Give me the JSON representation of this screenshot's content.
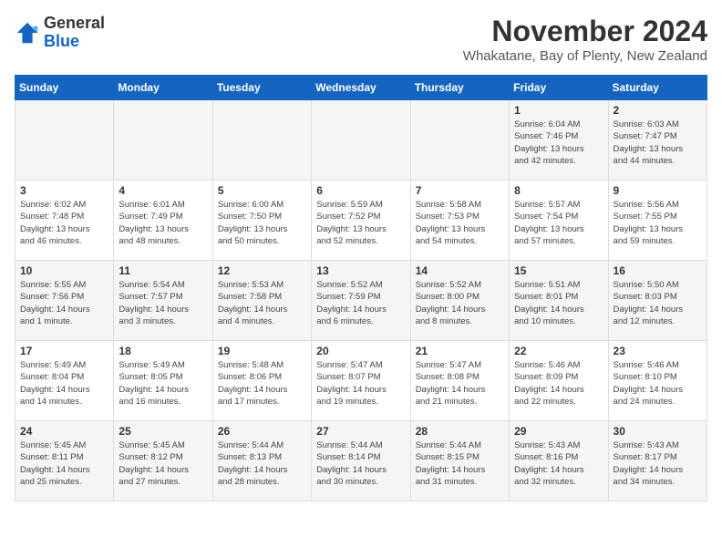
{
  "logo": {
    "line1": "General",
    "line2": "Blue"
  },
  "title": "November 2024",
  "location": "Whakatane, Bay of Plenty, New Zealand",
  "days_of_week": [
    "Sunday",
    "Monday",
    "Tuesday",
    "Wednesday",
    "Thursday",
    "Friday",
    "Saturday"
  ],
  "weeks": [
    [
      {
        "day": "",
        "info": ""
      },
      {
        "day": "",
        "info": ""
      },
      {
        "day": "",
        "info": ""
      },
      {
        "day": "",
        "info": ""
      },
      {
        "day": "",
        "info": ""
      },
      {
        "day": "1",
        "info": "Sunrise: 6:04 AM\nSunset: 7:46 PM\nDaylight: 13 hours\nand 42 minutes."
      },
      {
        "day": "2",
        "info": "Sunrise: 6:03 AM\nSunset: 7:47 PM\nDaylight: 13 hours\nand 44 minutes."
      }
    ],
    [
      {
        "day": "3",
        "info": "Sunrise: 6:02 AM\nSunset: 7:48 PM\nDaylight: 13 hours\nand 46 minutes."
      },
      {
        "day": "4",
        "info": "Sunrise: 6:01 AM\nSunset: 7:49 PM\nDaylight: 13 hours\nand 48 minutes."
      },
      {
        "day": "5",
        "info": "Sunrise: 6:00 AM\nSunset: 7:50 PM\nDaylight: 13 hours\nand 50 minutes."
      },
      {
        "day": "6",
        "info": "Sunrise: 5:59 AM\nSunset: 7:52 PM\nDaylight: 13 hours\nand 52 minutes."
      },
      {
        "day": "7",
        "info": "Sunrise: 5:58 AM\nSunset: 7:53 PM\nDaylight: 13 hours\nand 54 minutes."
      },
      {
        "day": "8",
        "info": "Sunrise: 5:57 AM\nSunset: 7:54 PM\nDaylight: 13 hours\nand 57 minutes."
      },
      {
        "day": "9",
        "info": "Sunrise: 5:56 AM\nSunset: 7:55 PM\nDaylight: 13 hours\nand 59 minutes."
      }
    ],
    [
      {
        "day": "10",
        "info": "Sunrise: 5:55 AM\nSunset: 7:56 PM\nDaylight: 14 hours\nand 1 minute."
      },
      {
        "day": "11",
        "info": "Sunrise: 5:54 AM\nSunset: 7:57 PM\nDaylight: 14 hours\nand 3 minutes."
      },
      {
        "day": "12",
        "info": "Sunrise: 5:53 AM\nSunset: 7:58 PM\nDaylight: 14 hours\nand 4 minutes."
      },
      {
        "day": "13",
        "info": "Sunrise: 5:52 AM\nSunset: 7:59 PM\nDaylight: 14 hours\nand 6 minutes."
      },
      {
        "day": "14",
        "info": "Sunrise: 5:52 AM\nSunset: 8:00 PM\nDaylight: 14 hours\nand 8 minutes."
      },
      {
        "day": "15",
        "info": "Sunrise: 5:51 AM\nSunset: 8:01 PM\nDaylight: 14 hours\nand 10 minutes."
      },
      {
        "day": "16",
        "info": "Sunrise: 5:50 AM\nSunset: 8:03 PM\nDaylight: 14 hours\nand 12 minutes."
      }
    ],
    [
      {
        "day": "17",
        "info": "Sunrise: 5:49 AM\nSunset: 8:04 PM\nDaylight: 14 hours\nand 14 minutes."
      },
      {
        "day": "18",
        "info": "Sunrise: 5:49 AM\nSunset: 8:05 PM\nDaylight: 14 hours\nand 16 minutes."
      },
      {
        "day": "19",
        "info": "Sunrise: 5:48 AM\nSunset: 8:06 PM\nDaylight: 14 hours\nand 17 minutes."
      },
      {
        "day": "20",
        "info": "Sunrise: 5:47 AM\nSunset: 8:07 PM\nDaylight: 14 hours\nand 19 minutes."
      },
      {
        "day": "21",
        "info": "Sunrise: 5:47 AM\nSunset: 8:08 PM\nDaylight: 14 hours\nand 21 minutes."
      },
      {
        "day": "22",
        "info": "Sunrise: 5:46 AM\nSunset: 8:09 PM\nDaylight: 14 hours\nand 22 minutes."
      },
      {
        "day": "23",
        "info": "Sunrise: 5:46 AM\nSunset: 8:10 PM\nDaylight: 14 hours\nand 24 minutes."
      }
    ],
    [
      {
        "day": "24",
        "info": "Sunrise: 5:45 AM\nSunset: 8:11 PM\nDaylight: 14 hours\nand 25 minutes."
      },
      {
        "day": "25",
        "info": "Sunrise: 5:45 AM\nSunset: 8:12 PM\nDaylight: 14 hours\nand 27 minutes."
      },
      {
        "day": "26",
        "info": "Sunrise: 5:44 AM\nSunset: 8:13 PM\nDaylight: 14 hours\nand 28 minutes."
      },
      {
        "day": "27",
        "info": "Sunrise: 5:44 AM\nSunset: 8:14 PM\nDaylight: 14 hours\nand 30 minutes."
      },
      {
        "day": "28",
        "info": "Sunrise: 5:44 AM\nSunset: 8:15 PM\nDaylight: 14 hours\nand 31 minutes."
      },
      {
        "day": "29",
        "info": "Sunrise: 5:43 AM\nSunset: 8:16 PM\nDaylight: 14 hours\nand 32 minutes."
      },
      {
        "day": "30",
        "info": "Sunrise: 5:43 AM\nSunset: 8:17 PM\nDaylight: 14 hours\nand 34 minutes."
      }
    ]
  ]
}
